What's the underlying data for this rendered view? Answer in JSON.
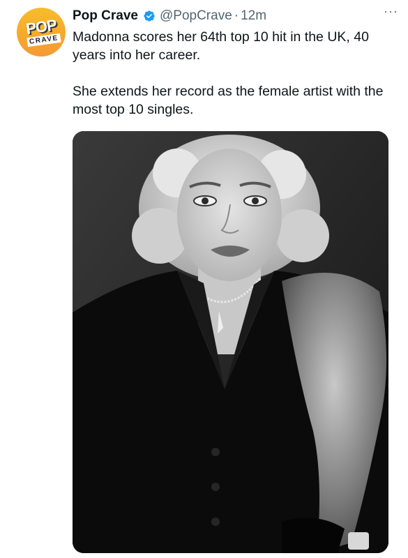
{
  "author": {
    "display_name": "Pop Crave",
    "handle": "@PopCrave",
    "separator": "·",
    "time": "12m",
    "verified": true,
    "avatar_logo_top": "POP",
    "avatar_logo_bottom": "CRAVE"
  },
  "more_menu": "···",
  "tweet": {
    "paragraphs": [
      "Madonna scores her 64th top 10 hit in the UK, 40 years into her career.",
      "She extends her record as the female artist with the most top 10 singles."
    ]
  },
  "media": {
    "alt": "black-and-white portrait photo",
    "style": "monochrome"
  },
  "colors": {
    "text_primary": "#0f1419",
    "text_secondary": "#536471",
    "verified_badge": "#1d9bf0",
    "avatar_gradient_top": "#f6bd2d",
    "avatar_gradient_bottom": "#f49a36"
  }
}
